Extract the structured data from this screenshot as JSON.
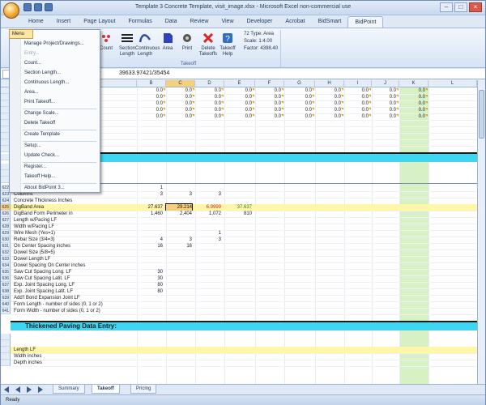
{
  "window": {
    "title": "Template 3 Concrete Template, visit_image.xlsx - Microsoft Excel non-commercial use"
  },
  "ribbon_tabs": [
    "Home",
    "Insert",
    "Page Layout",
    "Formulas",
    "Data",
    "Review",
    "View",
    "Developer",
    "Acrobat",
    "BidSmart",
    "BidPoint"
  ],
  "active_tab": "BidPoint",
  "ribbon": {
    "buttons": [
      {
        "label": "Count",
        "icon": "count-icon"
      },
      {
        "label": "Section Length",
        "icon": "section-length-icon"
      },
      {
        "label": "Continuous Length",
        "icon": "continuous-length-icon"
      },
      {
        "label": "Area",
        "icon": "area-icon"
      },
      {
        "label": "Print",
        "icon": "print-icon"
      },
      {
        "label": "Delete Takeoffs",
        "icon": "delete-icon"
      },
      {
        "label": "Takeoff Help",
        "icon": "help-icon"
      }
    ],
    "group_label": "Takeoff",
    "info_lines": [
      "72 Type: Area",
      "Scale: 1:4.00",
      "Factor: 4398.40"
    ]
  },
  "menu": {
    "head": "Menu",
    "items": [
      {
        "label": "Manage Project/Drawings...",
        "disabled": false
      },
      {
        "label": "Entry...",
        "disabled": true
      },
      {
        "label": "Count...",
        "disabled": false
      },
      {
        "label": "Section Length...",
        "disabled": false
      },
      {
        "label": "Continuous Length...",
        "disabled": false
      },
      {
        "label": "Area...",
        "disabled": false
      },
      {
        "label": "Print Takeoff...",
        "disabled": false
      },
      {
        "label": "Change Scale...",
        "disabled": false
      },
      {
        "label": "Delete Takeoff",
        "disabled": false
      },
      {
        "label": "Create Template",
        "disabled": false
      },
      {
        "label": "Setup...",
        "disabled": false
      },
      {
        "label": "Update Check...",
        "disabled": false
      },
      {
        "label": "Register...",
        "disabled": false
      },
      {
        "label": "Takeoff Help...",
        "disabled": false
      },
      {
        "label": "About BidPoint 3...",
        "disabled": false
      }
    ]
  },
  "formula_bar": {
    "fx": "fx",
    "value": "39633.97421/35454"
  },
  "columns": [
    "A",
    "B",
    "C",
    "D",
    "E",
    "F",
    "G",
    "H",
    "I",
    "J",
    "K",
    "L"
  ],
  "grid": {
    "top_values": "0.0",
    "top_rows": 5
  },
  "rows": [
    {
      "num": "622",
      "label": "Columns Total",
      "b": "1",
      "c": "",
      "d": "",
      "e": "",
      "f": ""
    },
    {
      "num": "623",
      "label": "Columns",
      "b": "3",
      "c": "3",
      "d": "3",
      "e": "",
      "f": ""
    },
    {
      "num": "624",
      "label": "Concrete Thickness Inches",
      "b": "",
      "c": "",
      "d": "",
      "e": "",
      "f": ""
    },
    {
      "num": "625",
      "label": "DigBand Area",
      "b": "27.637",
      "c": "29.214",
      "d": "6.9999",
      "e": "37.637",
      "f": "",
      "highlight": true
    },
    {
      "num": "626",
      "label": "DigBand Form Perimeter in",
      "b": "1,460",
      "c": "2,404",
      "d": "1,072",
      "e": "810",
      "f": ""
    },
    {
      "num": "627",
      "label": "Length w/Pacing LF",
      "b": "",
      "c": "",
      "d": "",
      "e": "",
      "f": ""
    },
    {
      "num": "628",
      "label": "Width w/Pacing LF",
      "b": "",
      "c": "",
      "d": "",
      "e": "",
      "f": ""
    },
    {
      "num": "629",
      "label": "Wire Mesh (Yes=1)",
      "b": "",
      "c": "",
      "d": "1",
      "e": "",
      "f": ""
    },
    {
      "num": "630",
      "label": "Rebar Size (3/4=3)",
      "b": "4",
      "c": "3",
      "d": "3",
      "e": "",
      "f": ""
    },
    {
      "num": "631",
      "label": "On Center Spacing inches",
      "b": "16",
      "c": "16",
      "d": "",
      "e": "",
      "f": ""
    },
    {
      "num": "632",
      "label": "Dowel Size (5/8=5)",
      "b": "",
      "c": "",
      "d": "",
      "e": "",
      "f": ""
    },
    {
      "num": "633",
      "label": "Dowel Length LF",
      "b": "",
      "c": "",
      "d": "",
      "e": "",
      "f": ""
    },
    {
      "num": "634",
      "label": "Dowel Spacing On Center inches",
      "b": "",
      "c": "",
      "d": "",
      "e": "",
      "f": ""
    },
    {
      "num": "635",
      "label": "Saw Cut Spacing Long. LF",
      "b": "30",
      "c": "",
      "d": "",
      "e": "",
      "f": ""
    },
    {
      "num": "636",
      "label": "Saw Cut Spacing Latit. LF",
      "b": "30",
      "c": "",
      "d": "",
      "e": "",
      "f": ""
    },
    {
      "num": "637",
      "label": "Exp. Joint Spacing Long. LF",
      "b": "80",
      "c": "",
      "d": "",
      "e": "",
      "f": ""
    },
    {
      "num": "638",
      "label": "Exp. Joint Spacing Latit. LF",
      "b": "80",
      "c": "",
      "d": "",
      "e": "",
      "f": ""
    },
    {
      "num": "639",
      "label": "Add'l Bond Expansion Joint LF",
      "b": "",
      "c": "",
      "d": "",
      "e": "",
      "f": ""
    },
    {
      "num": "640",
      "label": "Form Length - number of sides (0, 1 or 2)",
      "b": "",
      "c": "",
      "d": "",
      "e": "",
      "f": ""
    },
    {
      "num": "641",
      "label": "Form Width - number of sides (0, 1 or 2)",
      "b": "",
      "c": "",
      "d": "",
      "e": "",
      "f": ""
    }
  ],
  "section_title": "Thickened Paving Data Entry:",
  "bottom_rows": [
    "Length LF",
    "Width inches",
    "Depth inches"
  ],
  "sheet_tabs": [
    "Summary",
    "Takeoff",
    "Pricing"
  ],
  "active_sheet": "Takeoff",
  "status": "Ready"
}
